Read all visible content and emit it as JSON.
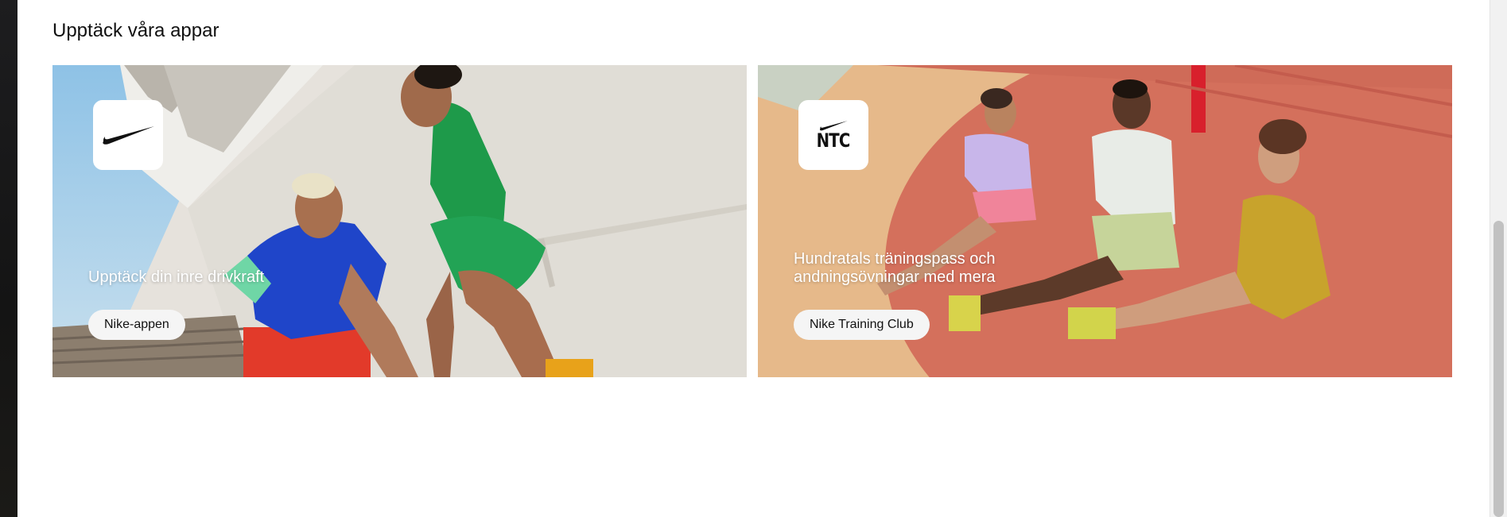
{
  "section": {
    "title": "Upptäck våra appar"
  },
  "cards": [
    {
      "text": "Upptäck din inre drivkraft",
      "button_label": "Nike-appen",
      "icon": "nike-swoosh-icon"
    },
    {
      "text": "Hundratals träningspass och andningsövningar med mera",
      "button_label": "Nike Training Club",
      "icon": "ntc-logo-icon",
      "icon_text": "NTC"
    }
  ],
  "colors": {
    "button_bg": "#f5f5f5",
    "text_on_image": "#ffffff",
    "title": "#111111"
  }
}
